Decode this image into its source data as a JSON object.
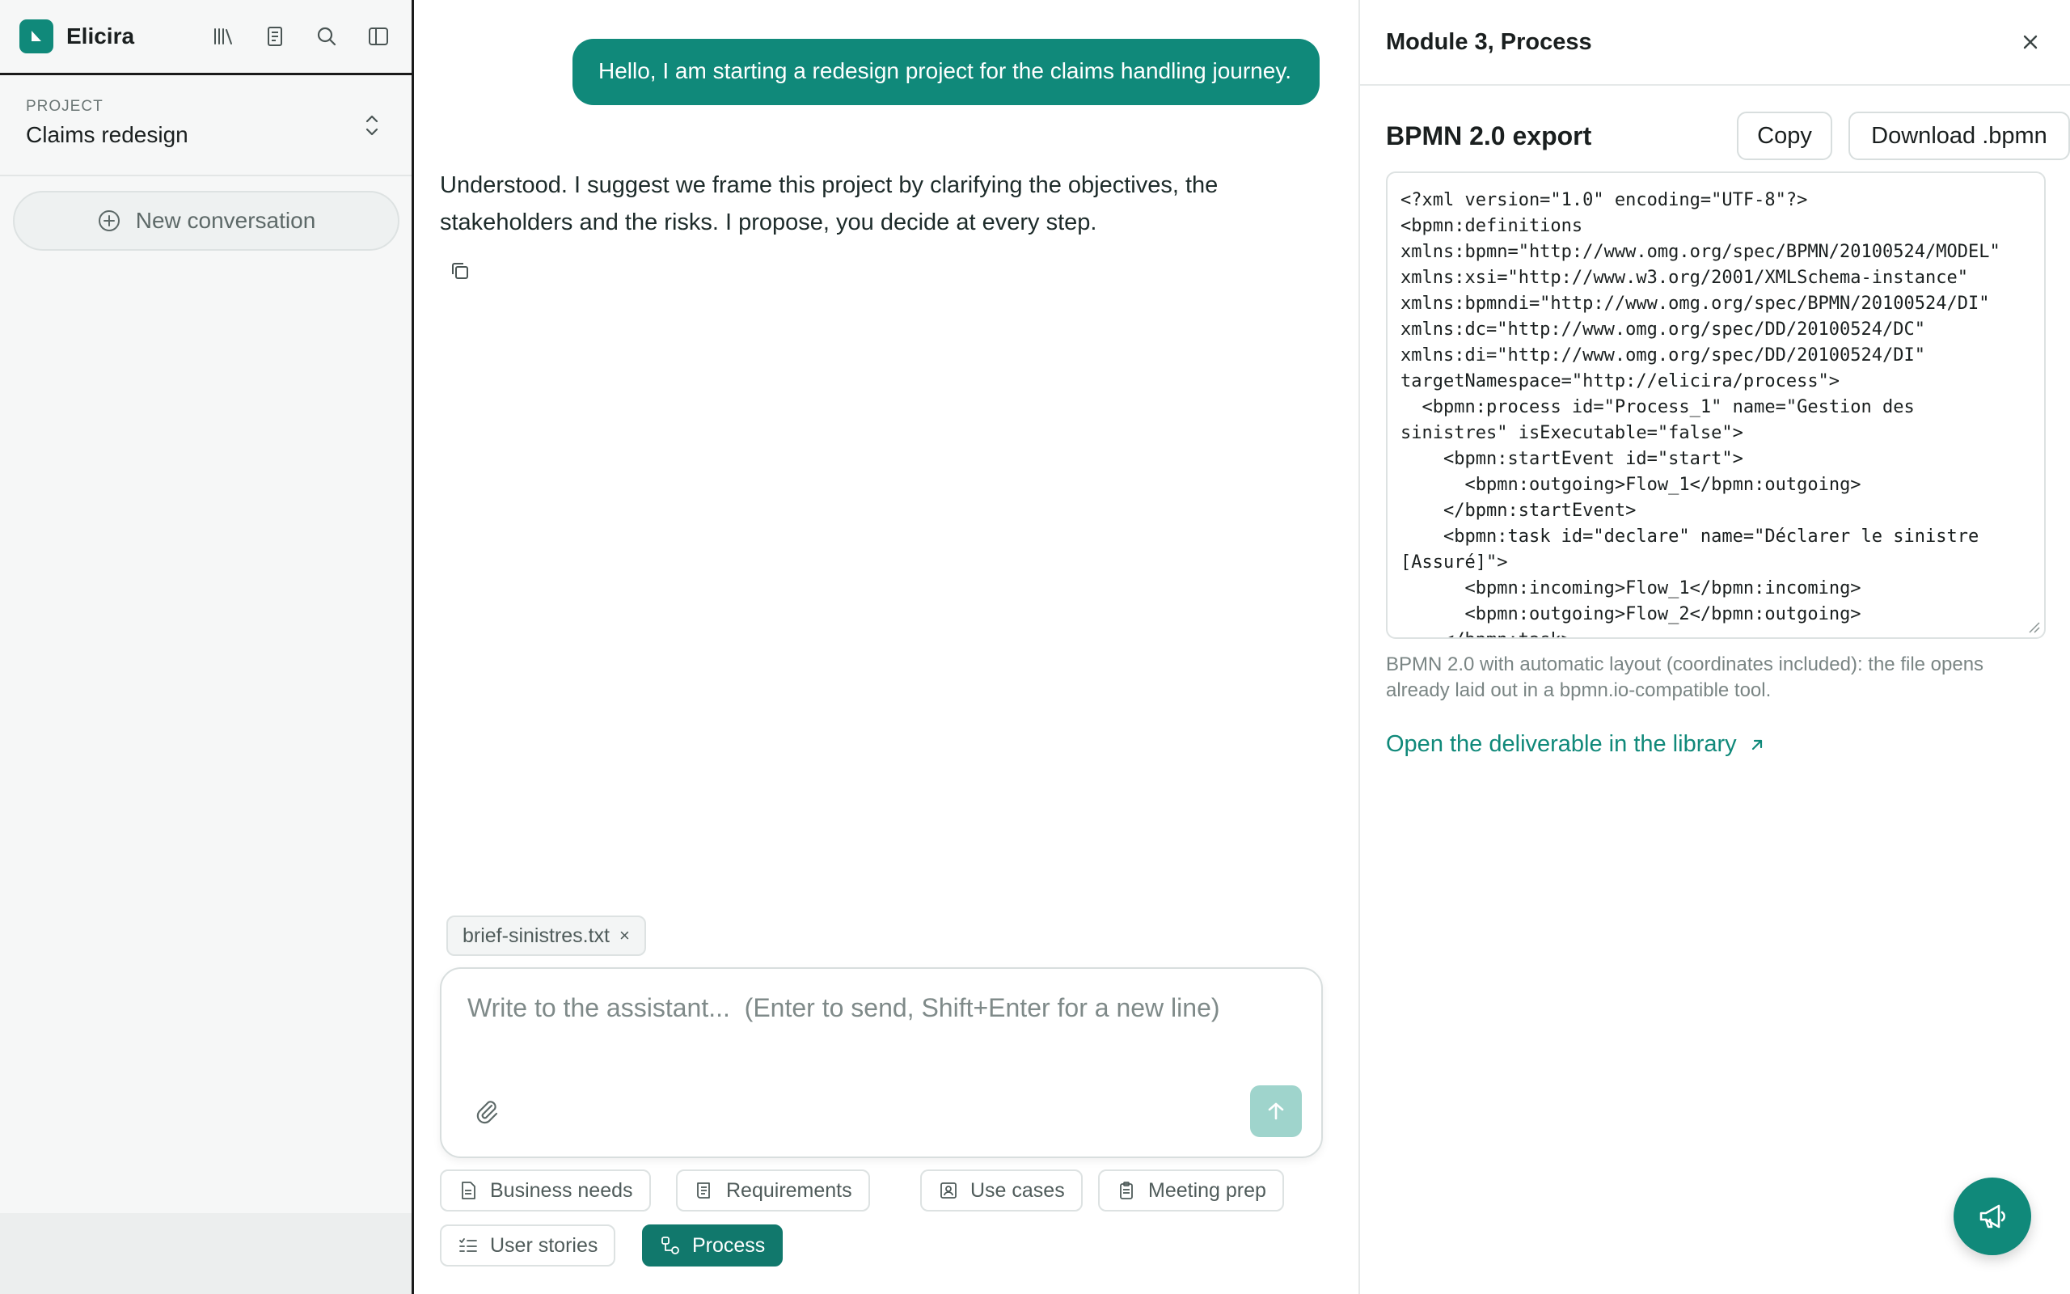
{
  "app": {
    "name": "Elicira",
    "brand_color": "#10897a"
  },
  "sidebar": {
    "icons": [
      "library-icon",
      "notebook-icon",
      "search-icon",
      "sidebar-toggle-icon"
    ],
    "project": {
      "label": "PROJECT",
      "name": "Claims redesign"
    },
    "new_conversation_label": "New conversation"
  },
  "chat": {
    "user_message": "Hello, I am starting a redesign project for the claims handling journey.",
    "assistant_message": "Understood. I suggest we frame this project by clarifying the objectives, the stakeholders and the risks. I propose, you decide at every step.",
    "attachment": {
      "filename": "brief-sinistres.txt",
      "remove_label": "×"
    },
    "composer": {
      "placeholder": "Write to the assistant...  (Enter to send, Shift+Enter for a new line)"
    },
    "chips": [
      {
        "label": "Business needs",
        "icon": "document-icon",
        "active": false
      },
      {
        "label": "Requirements",
        "icon": "checklist-doc-icon",
        "active": false
      },
      {
        "label": "Use cases",
        "icon": "user-card-icon",
        "active": false
      },
      {
        "label": "Meeting prep",
        "icon": "clipboard-icon",
        "active": false
      },
      {
        "label": "User stories",
        "icon": "list-check-icon",
        "active": false
      },
      {
        "label": "Process",
        "icon": "process-icon",
        "active": true
      }
    ]
  },
  "panel": {
    "title": "Module 3, Process",
    "export_title": "BPMN 2.0 export",
    "copy_label": "Copy",
    "download_label": "Download .bpmn",
    "xml": "<?xml version=\"1.0\" encoding=\"UTF-8\"?>\n<bpmn:definitions\nxmlns:bpmn=\"http://www.omg.org/spec/BPMN/20100524/MODEL\"\nxmlns:xsi=\"http://www.w3.org/2001/XMLSchema-instance\"\nxmlns:bpmndi=\"http://www.omg.org/spec/BPMN/20100524/DI\"\nxmlns:dc=\"http://www.omg.org/spec/DD/20100524/DC\"\nxmlns:di=\"http://www.omg.org/spec/DD/20100524/DI\"\ntargetNamespace=\"http://elicira/process\">\n  <bpmn:process id=\"Process_1\" name=\"Gestion des\nsinistres\" isExecutable=\"false\">\n    <bpmn:startEvent id=\"start\">\n      <bpmn:outgoing>Flow_1</bpmn:outgoing>\n    </bpmn:startEvent>\n    <bpmn:task id=\"declare\" name=\"Déclarer le sinistre\n[Assuré]\">\n      <bpmn:incoming>Flow_1</bpmn:incoming>\n      <bpmn:outgoing>Flow_2</bpmn:outgoing>\n    </bpmn:task>",
    "note": "BPMN 2.0 with automatic layout (coordinates included): the file opens already laid out in a bpmn.io-compatible tool.",
    "library_link": "Open the deliverable in the library"
  },
  "feedback_button_icon": "megaphone-icon"
}
